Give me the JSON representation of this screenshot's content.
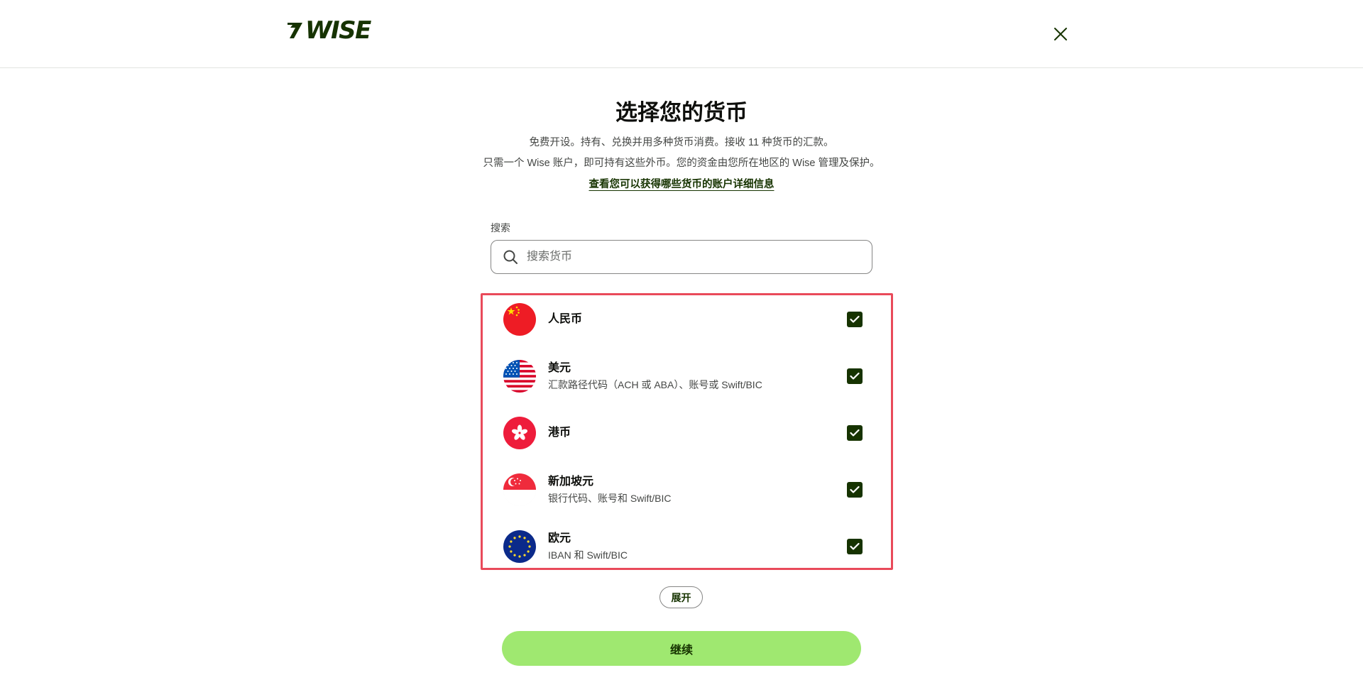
{
  "header": {
    "logo_text": "WISE"
  },
  "page": {
    "title": "选择您的货币",
    "description_line1": "免费开设。持有、兑换并用多种货币消费。接收 11 种货币的汇款。",
    "description_line2": "只需一个 Wise 账户，即可持有这些外币。您的资金由您所在地区的 Wise 管理及保护。",
    "details_link": "查看您可以获得哪些货币的账户详细信息"
  },
  "search": {
    "label": "搜索",
    "placeholder": "搜索货币",
    "value": ""
  },
  "currencies": [
    {
      "name": "人民币",
      "subtitle": "",
      "checked": true,
      "flag": "china-flag-icon"
    },
    {
      "name": "美元",
      "subtitle": "汇款路径代码（ACH 或 ABA）、账号或 Swift/BIC",
      "checked": true,
      "flag": "usa-flag-icon"
    },
    {
      "name": "港币",
      "subtitle": "",
      "checked": true,
      "flag": "hong-kong-flag-icon"
    },
    {
      "name": "新加坡元",
      "subtitle": "银行代码、账号和 Swift/BIC",
      "checked": true,
      "flag": "singapore-flag-icon"
    },
    {
      "name": "欧元",
      "subtitle": "IBAN 和 Swift/BIC",
      "checked": true,
      "flag": "eu-flag-icon"
    }
  ],
  "actions": {
    "expand_label": "展开",
    "continue_label": "继续"
  },
  "colors": {
    "brand_dark": "#163300",
    "brand_green": "#9fe870",
    "highlight_border": "#e94a5a"
  }
}
